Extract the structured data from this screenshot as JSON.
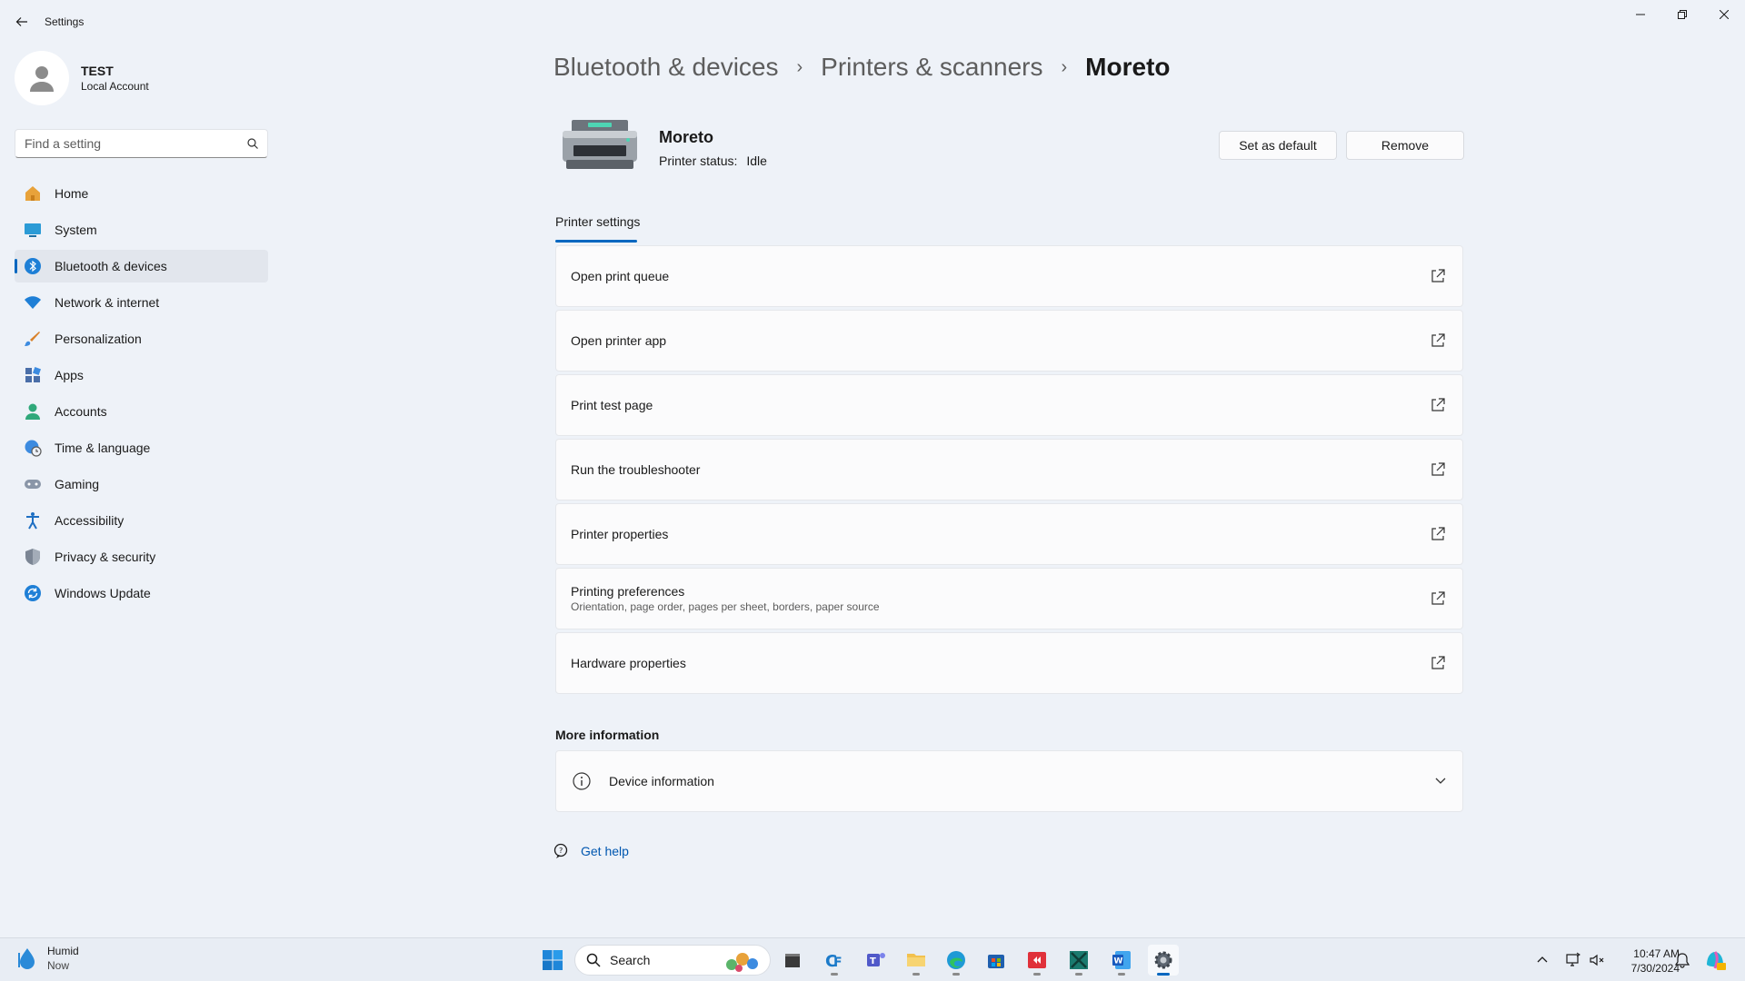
{
  "window": {
    "title": "Settings",
    "controls": [
      "minimize",
      "restore",
      "close"
    ]
  },
  "profile": {
    "name": "TEST",
    "account_type": "Local Account"
  },
  "search": {
    "placeholder": "Find a setting"
  },
  "sidebar": {
    "items": [
      {
        "label": "Home",
        "icon": "home-icon",
        "active": false
      },
      {
        "label": "System",
        "icon": "system-icon",
        "active": false
      },
      {
        "label": "Bluetooth & devices",
        "icon": "bluetooth-icon",
        "active": true
      },
      {
        "label": "Network & internet",
        "icon": "wifi-icon",
        "active": false
      },
      {
        "label": "Personalization",
        "icon": "brush-icon",
        "active": false
      },
      {
        "label": "Apps",
        "icon": "apps-icon",
        "active": false
      },
      {
        "label": "Accounts",
        "icon": "accounts-icon",
        "active": false
      },
      {
        "label": "Time & language",
        "icon": "globe-clock-icon",
        "active": false
      },
      {
        "label": "Gaming",
        "icon": "gamepad-icon",
        "active": false
      },
      {
        "label": "Accessibility",
        "icon": "accessibility-icon",
        "active": false
      },
      {
        "label": "Privacy & security",
        "icon": "shield-icon",
        "active": false
      },
      {
        "label": "Windows Update",
        "icon": "update-icon",
        "active": false
      }
    ]
  },
  "breadcrumb": {
    "items": [
      "Bluetooth & devices",
      "Printers & scanners",
      "Moreto"
    ]
  },
  "printer": {
    "name": "Moreto",
    "status_label": "Printer status:",
    "status_value": "Idle",
    "set_default_label": "Set as default",
    "remove_label": "Remove"
  },
  "tabs": {
    "printer_settings": "Printer settings"
  },
  "settings_items": [
    {
      "label": "Open print queue",
      "sublabel": ""
    },
    {
      "label": "Open printer app",
      "sublabel": ""
    },
    {
      "label": "Print test page",
      "sublabel": ""
    },
    {
      "label": "Run the troubleshooter",
      "sublabel": ""
    },
    {
      "label": "Printer properties",
      "sublabel": ""
    },
    {
      "label": "Printing preferences",
      "sublabel": "Orientation, page order, pages per sheet, borders, paper source"
    },
    {
      "label": "Hardware properties",
      "sublabel": ""
    }
  ],
  "more_info": {
    "title": "More information",
    "device_info_label": "Device information"
  },
  "help": {
    "label": "Get help"
  },
  "taskbar": {
    "weather_label": "Humid",
    "weather_sub": "Now",
    "search_label": "Search",
    "time": "10:47 AM",
    "date": "7/30/2024"
  },
  "colors": {
    "accent": "#0067c0",
    "background": "#eef2f8",
    "card": "#fbfbfc"
  }
}
